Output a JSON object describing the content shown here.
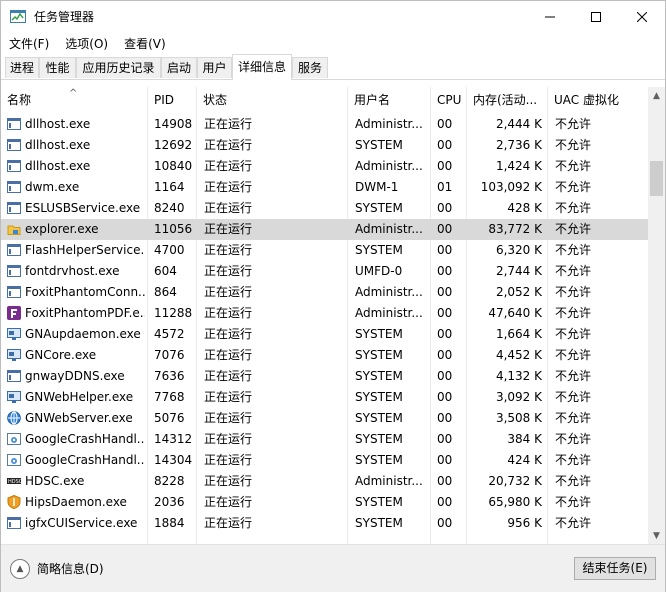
{
  "window": {
    "title": "任务管理器",
    "app_icon": "task-manager-icon"
  },
  "menu": [
    "文件(F)",
    "选项(O)",
    "查看(V)"
  ],
  "tabs": [
    "进程",
    "性能",
    "应用历史记录",
    "启动",
    "用户",
    "详细信息",
    "服务"
  ],
  "active_tab": "详细信息",
  "columns": [
    "名称",
    "PID",
    "状态",
    "用户名",
    "CPU",
    "内存(活动...",
    "UAC 虚拟化"
  ],
  "sort_column": "名称",
  "rows": [
    {
      "name": "dllhost.exe",
      "pid": "14908",
      "status": "正在运行",
      "user": "Administr...",
      "cpu": "00",
      "mem": "2,444 K",
      "uac": "不允许",
      "icon": "generic-app-icon"
    },
    {
      "name": "dllhost.exe",
      "pid": "12692",
      "status": "正在运行",
      "user": "SYSTEM",
      "cpu": "00",
      "mem": "2,736 K",
      "uac": "不允许",
      "icon": "generic-app-icon"
    },
    {
      "name": "dllhost.exe",
      "pid": "10840",
      "status": "正在运行",
      "user": "Administr...",
      "cpu": "00",
      "mem": "1,424 K",
      "uac": "不允许",
      "icon": "generic-app-icon"
    },
    {
      "name": "dwm.exe",
      "pid": "1164",
      "status": "正在运行",
      "user": "DWM-1",
      "cpu": "01",
      "mem": "103,092 K",
      "uac": "不允许",
      "icon": "generic-app-icon"
    },
    {
      "name": "ESLUSBService.exe",
      "pid": "8240",
      "status": "正在运行",
      "user": "SYSTEM",
      "cpu": "00",
      "mem": "428 K",
      "uac": "不允许",
      "icon": "generic-app-icon"
    },
    {
      "name": "explorer.exe",
      "pid": "11056",
      "status": "正在运行",
      "user": "Administr...",
      "cpu": "00",
      "mem": "83,772 K",
      "uac": "不允许",
      "icon": "folder-icon"
    },
    {
      "name": "FlashHelperService...",
      "pid": "4700",
      "status": "正在运行",
      "user": "SYSTEM",
      "cpu": "00",
      "mem": "6,320 K",
      "uac": "不允许",
      "icon": "generic-app-icon"
    },
    {
      "name": "fontdrvhost.exe",
      "pid": "604",
      "status": "正在运行",
      "user": "UMFD-0",
      "cpu": "00",
      "mem": "2,744 K",
      "uac": "不允许",
      "icon": "generic-app-icon"
    },
    {
      "name": "FoxitPhantomConn...",
      "pid": "864",
      "status": "正在运行",
      "user": "Administr...",
      "cpu": "00",
      "mem": "2,052 K",
      "uac": "不允许",
      "icon": "generic-app-icon"
    },
    {
      "name": "FoxitPhantomPDF.e...",
      "pid": "11288",
      "status": "正在运行",
      "user": "Administr...",
      "cpu": "00",
      "mem": "47,640 K",
      "uac": "不允许",
      "icon": "foxit-icon"
    },
    {
      "name": "GNAupdaemon.exe",
      "pid": "4572",
      "status": "正在运行",
      "user": "SYSTEM",
      "cpu": "00",
      "mem": "1,664 K",
      "uac": "不允许",
      "icon": "monitor-icon"
    },
    {
      "name": "GNCore.exe",
      "pid": "7076",
      "status": "正在运行",
      "user": "SYSTEM",
      "cpu": "00",
      "mem": "4,452 K",
      "uac": "不允许",
      "icon": "monitor-icon"
    },
    {
      "name": "gnwayDDNS.exe",
      "pid": "7636",
      "status": "正在运行",
      "user": "SYSTEM",
      "cpu": "00",
      "mem": "4,132 K",
      "uac": "不允许",
      "icon": "generic-app-icon"
    },
    {
      "name": "GNWebHelper.exe",
      "pid": "7768",
      "status": "正在运行",
      "user": "SYSTEM",
      "cpu": "00",
      "mem": "3,092 K",
      "uac": "不允许",
      "icon": "monitor-icon"
    },
    {
      "name": "GNWebServer.exe",
      "pid": "5076",
      "status": "正在运行",
      "user": "SYSTEM",
      "cpu": "00",
      "mem": "3,508 K",
      "uac": "不允许",
      "icon": "globe-icon"
    },
    {
      "name": "GoogleCrashHandl...",
      "pid": "14312",
      "status": "正在运行",
      "user": "SYSTEM",
      "cpu": "00",
      "mem": "384 K",
      "uac": "不允许",
      "icon": "gear-app-icon"
    },
    {
      "name": "GoogleCrashHandl...",
      "pid": "14304",
      "status": "正在运行",
      "user": "SYSTEM",
      "cpu": "00",
      "mem": "424 K",
      "uac": "不允许",
      "icon": "gear-app-icon"
    },
    {
      "name": "HDSC.exe",
      "pid": "8228",
      "status": "正在运行",
      "user": "Administr...",
      "cpu": "00",
      "mem": "20,732 K",
      "uac": "不允许",
      "icon": "hdsc-icon"
    },
    {
      "name": "HipsDaemon.exe",
      "pid": "2036",
      "status": "正在运行",
      "user": "SYSTEM",
      "cpu": "00",
      "mem": "65,980 K",
      "uac": "不允许",
      "icon": "shield-icon"
    },
    {
      "name": "igfxCUIService.exe",
      "pid": "1884",
      "status": "正在运行",
      "user": "SYSTEM",
      "cpu": "00",
      "mem": "956 K",
      "uac": "不允许",
      "icon": "generic-app-icon"
    }
  ],
  "selected_row": "explorer.exe",
  "footer": {
    "fewer_details": "简略信息(D)",
    "end_task": "结束任务(E)"
  },
  "colors": {
    "selected_row": "#d9d9d9",
    "footer_bg": "#f0f0f0",
    "button_bg": "#e1e1e1"
  }
}
